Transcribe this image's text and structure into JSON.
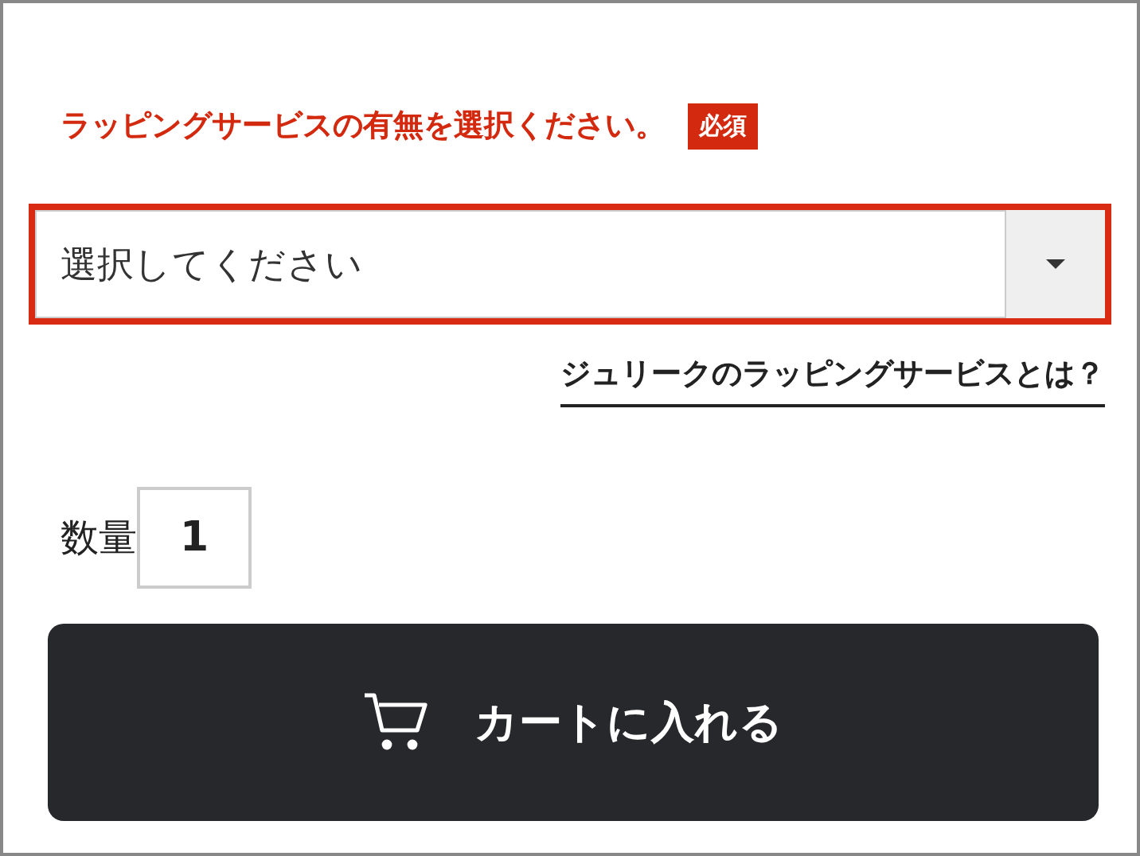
{
  "wrapping": {
    "message": "ラッピングサービスの有無を選択ください。",
    "required_badge": "必須",
    "select": {
      "value": "選択してください",
      "error": true
    },
    "link": "ジュリークのラッピングサービスとは？"
  },
  "quantity": {
    "label": "数量",
    "value": "1"
  },
  "cart_button": {
    "label": "カートに入れる"
  }
}
